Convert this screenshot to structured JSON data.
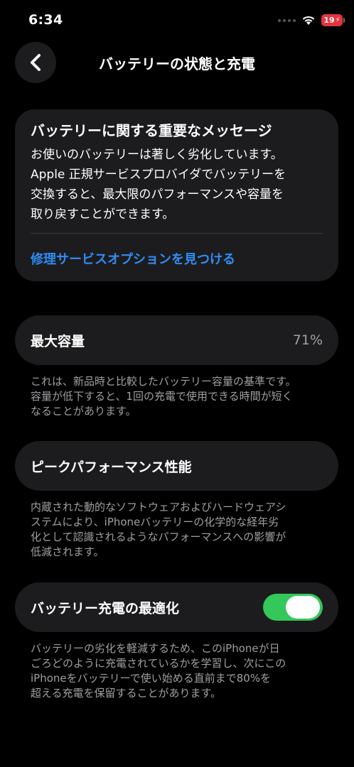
{
  "status_bar": {
    "time": "6:34",
    "battery_level": "19",
    "battery_color": "#e5343d",
    "icons": [
      "signal-dots-icon",
      "wifi-icon",
      "battery-charging-icon"
    ]
  },
  "nav": {
    "back_icon": "chevron-left-icon",
    "title": "バッテリーの状態と充電"
  },
  "message_card": {
    "title": "バッテリーに関する重要なメッセージ",
    "body_lines": [
      "お使いのバッテリーは著しく劣化しています。",
      "Apple 正規サービスプロバイダでバッテリーを",
      "交換すると、最大限のパフォーマンスや容量を",
      "取り戻すことができます。"
    ],
    "link": "修理サービスオプションを見つける",
    "link_color": "#2f8cf6"
  },
  "capacity": {
    "label": "最大容量",
    "value": "71%",
    "note_lines": [
      "これは、新品時と比較したバッテリー容量の基準です。",
      "容量が低下すると、1回の充電で使用できる時間が短く",
      "なることがあります。"
    ]
  },
  "peak_performance": {
    "label": "ピークパフォーマンス性能",
    "note_lines": [
      "内蔵された動的なソフトウェアおよびハードウェアシ",
      "ステムにより、iPhoneバッテリーの化学的な経年劣",
      "化として認識されるようなパフォーマンスへの影響が",
      "低減されます。"
    ]
  },
  "optimized_charging": {
    "label": "バッテリー充電の最適化",
    "enabled": true,
    "toggle_color": "#34c759",
    "note_lines": [
      "バッテリーの劣化を軽減するため、このiPhoneが日",
      "ごろどのように充電されているかを学習し、次にこの",
      "iPhoneをバッテリーで使い始める直前まで80%を",
      "超える充電を保留することがあります。"
    ]
  }
}
